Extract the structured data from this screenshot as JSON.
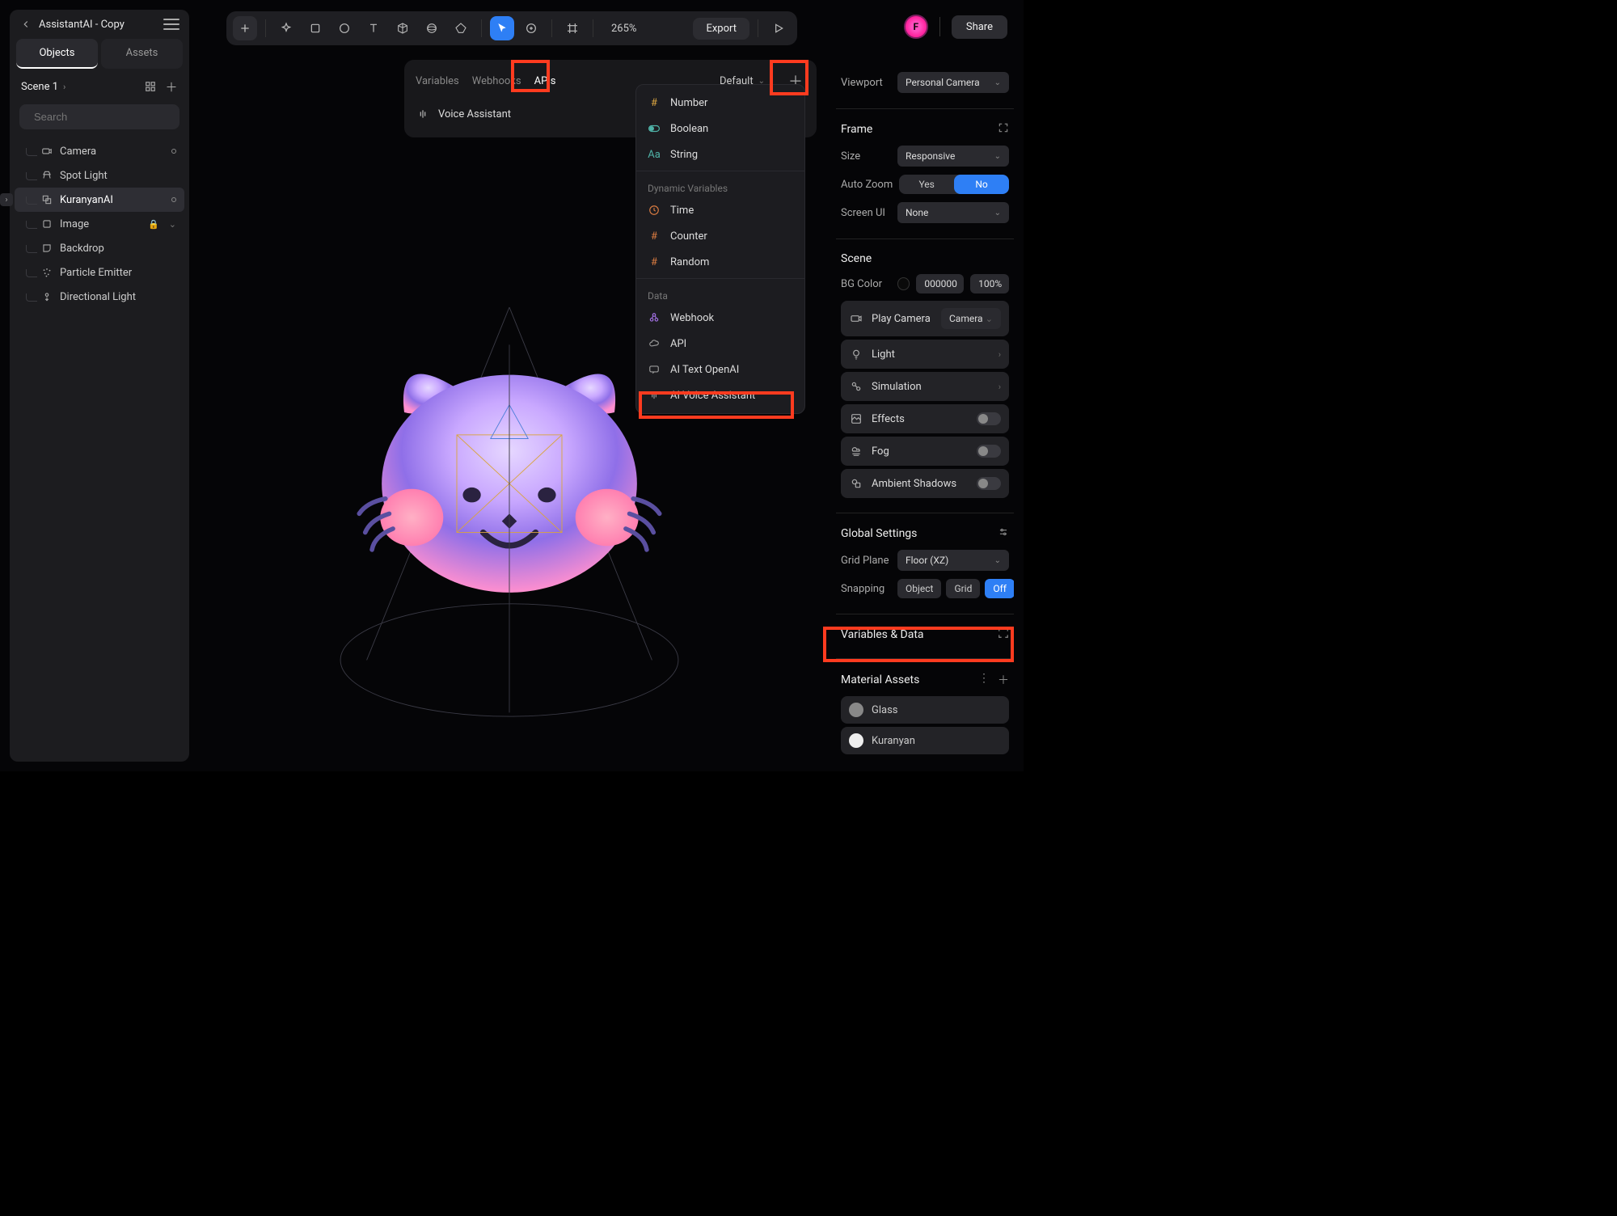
{
  "project": {
    "title": "AssistantAI - Copy"
  },
  "left": {
    "tabs": {
      "objects": "Objects",
      "assets": "Assets"
    },
    "scene_label": "Scene 1",
    "search_placeholder": "Search",
    "tree": [
      {
        "name": "Camera",
        "icon": "camera",
        "badge_dot": true
      },
      {
        "name": "Spot Light",
        "icon": "spotlight"
      },
      {
        "name": "KuranyanAI",
        "icon": "group",
        "selected": true,
        "expand": true,
        "badge_dot": true
      },
      {
        "name": "Image",
        "icon": "rect",
        "badge_lock": true
      },
      {
        "name": "Backdrop",
        "icon": "backdrop"
      },
      {
        "name": "Particle Emitter",
        "icon": "particles"
      },
      {
        "name": "Directional Light",
        "icon": "dirlight"
      }
    ]
  },
  "toolbar": {
    "zoom": "265%",
    "export": "Export"
  },
  "header": {
    "avatar_letter": "F",
    "share": "Share"
  },
  "var_panel": {
    "tabs": {
      "variables": "Variables",
      "webhooks": "Webhooks",
      "apis": "APIs"
    },
    "default": "Default",
    "row_label": "Voice Assistant"
  },
  "dropdown": {
    "top": [
      {
        "label": "Number",
        "icon": "hash",
        "cls": "ico-yellow"
      },
      {
        "label": "Boolean",
        "icon": "toggle",
        "cls": "ico-teal"
      },
      {
        "label": "String",
        "icon": "aa",
        "cls": "ico-teal"
      }
    ],
    "dyn_title": "Dynamic Variables",
    "dyn": [
      {
        "label": "Time",
        "icon": "clock",
        "cls": "ico-orange"
      },
      {
        "label": "Counter",
        "icon": "hash",
        "cls": "ico-orange"
      },
      {
        "label": "Random",
        "icon": "hash",
        "cls": "ico-orange"
      }
    ],
    "data_title": "Data",
    "data": [
      {
        "label": "Webhook",
        "icon": "webhook",
        "cls": "ico-purple"
      },
      {
        "label": "API",
        "icon": "cloud",
        "cls": "ico-grey"
      },
      {
        "label": "AI Text OpenAI",
        "icon": "chat",
        "cls": "ico-grey"
      },
      {
        "label": "AI Voice Assistant",
        "icon": "voice",
        "cls": "ico-grey"
      }
    ]
  },
  "right": {
    "viewport_label": "Viewport",
    "viewport_value": "Personal Camera",
    "frame_title": "Frame",
    "size_label": "Size",
    "size_value": "Responsive",
    "autozoom_label": "Auto Zoom",
    "autozoom_yes": "Yes",
    "autozoom_no": "No",
    "screenui_label": "Screen UI",
    "screenui_value": "None",
    "scene_title": "Scene",
    "bgcolor_label": "BG Color",
    "bgcolor_hex": "000000",
    "bgcolor_pct": "100%",
    "playcam_label": "Play Camera",
    "playcam_value": "Camera",
    "light": "Light",
    "simulation": "Simulation",
    "effects": "Effects",
    "fog": "Fog",
    "ambient": "Ambient Shadows",
    "global_title": "Global Settings",
    "gridplane_label": "Grid Plane",
    "gridplane_value": "Floor (XZ)",
    "snapping_label": "Snapping",
    "snap_object": "Object",
    "snap_grid": "Grid",
    "snap_off": "Off",
    "vardata_title": "Variables & Data",
    "matassets_title": "Material Assets",
    "materials": [
      {
        "label": "Glass",
        "swatch": "sw-grey"
      },
      {
        "label": "Kuranyan",
        "swatch": "sw-white"
      }
    ]
  }
}
